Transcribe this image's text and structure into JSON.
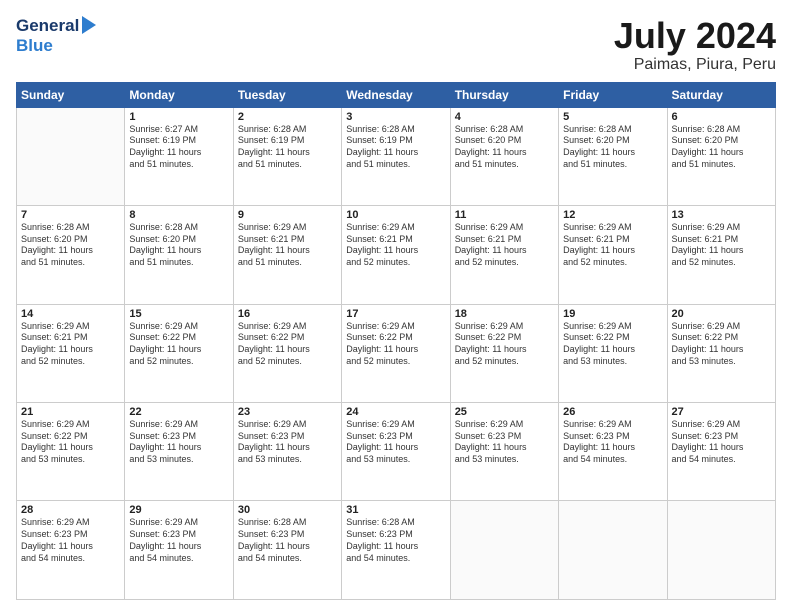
{
  "header": {
    "logo_general": "General",
    "logo_blue": "Blue",
    "title": "July 2024",
    "subtitle": "Paimas, Piura, Peru"
  },
  "calendar": {
    "days_of_week": [
      "Sunday",
      "Monday",
      "Tuesday",
      "Wednesday",
      "Thursday",
      "Friday",
      "Saturday"
    ],
    "weeks": [
      [
        {
          "day": "",
          "info": ""
        },
        {
          "day": "1",
          "info": "Sunrise: 6:27 AM\nSunset: 6:19 PM\nDaylight: 11 hours\nand 51 minutes."
        },
        {
          "day": "2",
          "info": "Sunrise: 6:28 AM\nSunset: 6:19 PM\nDaylight: 11 hours\nand 51 minutes."
        },
        {
          "day": "3",
          "info": "Sunrise: 6:28 AM\nSunset: 6:19 PM\nDaylight: 11 hours\nand 51 minutes."
        },
        {
          "day": "4",
          "info": "Sunrise: 6:28 AM\nSunset: 6:20 PM\nDaylight: 11 hours\nand 51 minutes."
        },
        {
          "day": "5",
          "info": "Sunrise: 6:28 AM\nSunset: 6:20 PM\nDaylight: 11 hours\nand 51 minutes."
        },
        {
          "day": "6",
          "info": "Sunrise: 6:28 AM\nSunset: 6:20 PM\nDaylight: 11 hours\nand 51 minutes."
        }
      ],
      [
        {
          "day": "7",
          "info": "Sunrise: 6:28 AM\nSunset: 6:20 PM\nDaylight: 11 hours\nand 51 minutes."
        },
        {
          "day": "8",
          "info": "Sunrise: 6:28 AM\nSunset: 6:20 PM\nDaylight: 11 hours\nand 51 minutes."
        },
        {
          "day": "9",
          "info": "Sunrise: 6:29 AM\nSunset: 6:21 PM\nDaylight: 11 hours\nand 51 minutes."
        },
        {
          "day": "10",
          "info": "Sunrise: 6:29 AM\nSunset: 6:21 PM\nDaylight: 11 hours\nand 52 minutes."
        },
        {
          "day": "11",
          "info": "Sunrise: 6:29 AM\nSunset: 6:21 PM\nDaylight: 11 hours\nand 52 minutes."
        },
        {
          "day": "12",
          "info": "Sunrise: 6:29 AM\nSunset: 6:21 PM\nDaylight: 11 hours\nand 52 minutes."
        },
        {
          "day": "13",
          "info": "Sunrise: 6:29 AM\nSunset: 6:21 PM\nDaylight: 11 hours\nand 52 minutes."
        }
      ],
      [
        {
          "day": "14",
          "info": "Sunrise: 6:29 AM\nSunset: 6:21 PM\nDaylight: 11 hours\nand 52 minutes."
        },
        {
          "day": "15",
          "info": "Sunrise: 6:29 AM\nSunset: 6:22 PM\nDaylight: 11 hours\nand 52 minutes."
        },
        {
          "day": "16",
          "info": "Sunrise: 6:29 AM\nSunset: 6:22 PM\nDaylight: 11 hours\nand 52 minutes."
        },
        {
          "day": "17",
          "info": "Sunrise: 6:29 AM\nSunset: 6:22 PM\nDaylight: 11 hours\nand 52 minutes."
        },
        {
          "day": "18",
          "info": "Sunrise: 6:29 AM\nSunset: 6:22 PM\nDaylight: 11 hours\nand 52 minutes."
        },
        {
          "day": "19",
          "info": "Sunrise: 6:29 AM\nSunset: 6:22 PM\nDaylight: 11 hours\nand 53 minutes."
        },
        {
          "day": "20",
          "info": "Sunrise: 6:29 AM\nSunset: 6:22 PM\nDaylight: 11 hours\nand 53 minutes."
        }
      ],
      [
        {
          "day": "21",
          "info": "Sunrise: 6:29 AM\nSunset: 6:22 PM\nDaylight: 11 hours\nand 53 minutes."
        },
        {
          "day": "22",
          "info": "Sunrise: 6:29 AM\nSunset: 6:23 PM\nDaylight: 11 hours\nand 53 minutes."
        },
        {
          "day": "23",
          "info": "Sunrise: 6:29 AM\nSunset: 6:23 PM\nDaylight: 11 hours\nand 53 minutes."
        },
        {
          "day": "24",
          "info": "Sunrise: 6:29 AM\nSunset: 6:23 PM\nDaylight: 11 hours\nand 53 minutes."
        },
        {
          "day": "25",
          "info": "Sunrise: 6:29 AM\nSunset: 6:23 PM\nDaylight: 11 hours\nand 53 minutes."
        },
        {
          "day": "26",
          "info": "Sunrise: 6:29 AM\nSunset: 6:23 PM\nDaylight: 11 hours\nand 54 minutes."
        },
        {
          "day": "27",
          "info": "Sunrise: 6:29 AM\nSunset: 6:23 PM\nDaylight: 11 hours\nand 54 minutes."
        }
      ],
      [
        {
          "day": "28",
          "info": "Sunrise: 6:29 AM\nSunset: 6:23 PM\nDaylight: 11 hours\nand 54 minutes."
        },
        {
          "day": "29",
          "info": "Sunrise: 6:29 AM\nSunset: 6:23 PM\nDaylight: 11 hours\nand 54 minutes."
        },
        {
          "day": "30",
          "info": "Sunrise: 6:28 AM\nSunset: 6:23 PM\nDaylight: 11 hours\nand 54 minutes."
        },
        {
          "day": "31",
          "info": "Sunrise: 6:28 AM\nSunset: 6:23 PM\nDaylight: 11 hours\nand 54 minutes."
        },
        {
          "day": "",
          "info": ""
        },
        {
          "day": "",
          "info": ""
        },
        {
          "day": "",
          "info": ""
        }
      ]
    ]
  }
}
